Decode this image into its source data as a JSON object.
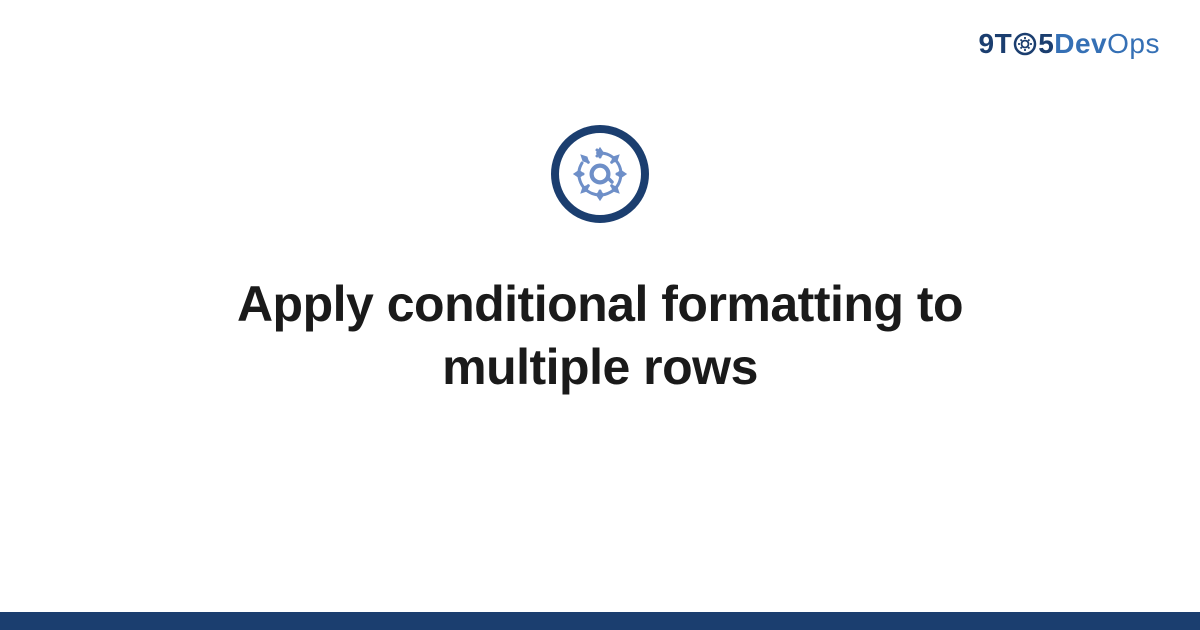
{
  "logo": {
    "part1": "9T",
    "part2": "5",
    "part3": "Dev",
    "part4": "Ops"
  },
  "main": {
    "title": "Apply conditional formatting to multiple rows"
  },
  "colors": {
    "brand_dark": "#1b3e6f",
    "brand_light": "#3570b5",
    "icon_gear": "#6e8fc8"
  }
}
